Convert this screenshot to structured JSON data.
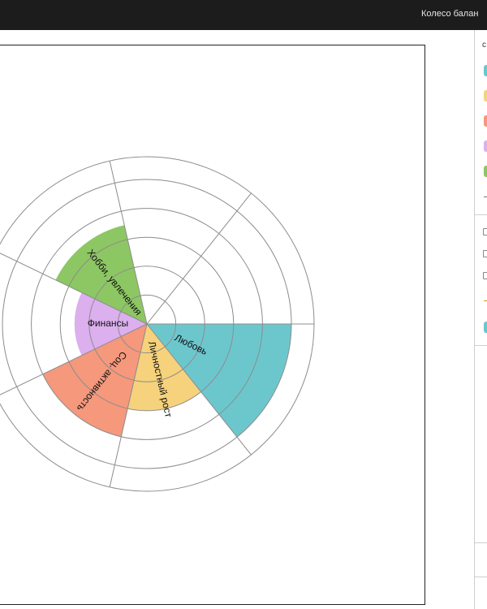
{
  "app": {
    "title": "Колесо балан"
  },
  "chart_data": {
    "type": "polar-area",
    "max": 5,
    "rings": 5,
    "sectors": [
      {
        "label": "Любовь",
        "value": 5,
        "color": "#6cc7cd"
      },
      {
        "label": "Личностный рост",
        "value": 3,
        "color": "#f6d27c"
      },
      {
        "label": "Соц. активность",
        "value": 4,
        "color": "#f5987c"
      },
      {
        "label": "Финансы",
        "value": 2.5,
        "color": "#dcafee"
      },
      {
        "label": "Хобби, увлечения",
        "value": 3.5,
        "color": "#8dc764"
      },
      {
        "label": "",
        "value": 0,
        "color": "#cccccc"
      },
      {
        "label": "",
        "value": 0,
        "color": "#cccccc"
      }
    ]
  },
  "sidebar": {
    "legend_colors": [
      "#6cc7cd",
      "#f6d27c",
      "#f5987c",
      "#dcafee",
      "#8dc764"
    ],
    "accent_color": "#6cc7cd"
  }
}
